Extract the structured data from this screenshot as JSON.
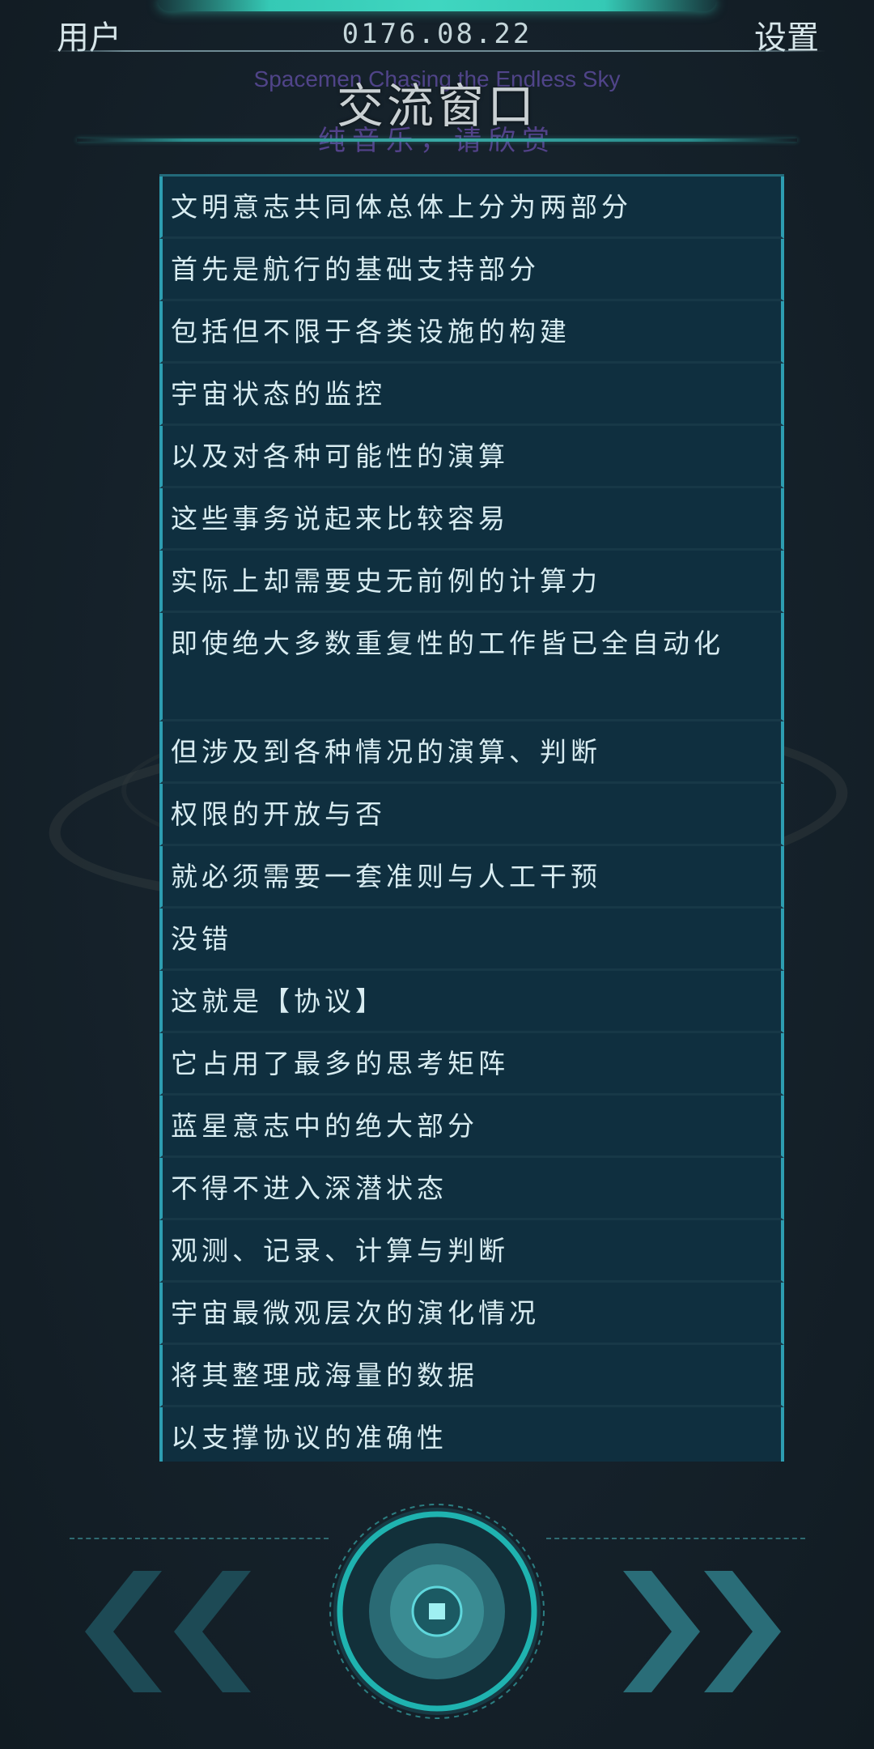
{
  "header": {
    "user_label": "用户",
    "date": "0176.08.22",
    "settings_label": "设置"
  },
  "window": {
    "title": "交流窗口",
    "song_title": "Spacemen Chasing the Endless Sky",
    "song_note": "纯音乐，请欣赏"
  },
  "messages": [
    "文明意志共同体总体上分为两部分",
    "首先是航行的基础支持部分",
    "包括但不限于各类设施的构建",
    "宇宙状态的监控",
    "以及对各种可能性的演算",
    "这些事务说起来比较容易",
    "实际上却需要史无前例的计算力",
    "即使绝大多数重复性的工作皆已全自动化",
    "但涉及到各种情况的演算、判断",
    "权限的开放与否",
    "就必须需要一套准则与人工干预",
    "没错",
    "这就是【协议】",
    "它占用了最多的思考矩阵",
    "蓝星意志中的绝大部分",
    "不得不进入深潜状态",
    "观测、记录、计算与判断",
    "宇宙最微观层次的演化情况",
    "将其整理成海量的数据",
    "以支撑协议的准确性"
  ],
  "controls": {
    "prev_icon": "double-chevron-left-icon",
    "play_icon": "record-button-icon",
    "next_icon": "double-chevron-right-icon"
  },
  "colors": {
    "accent": "#35c9b5",
    "panel": "#0f2f3f",
    "panel_border": "#2d9db1",
    "background": "#15212a",
    "song_text": "#6e50b4"
  }
}
